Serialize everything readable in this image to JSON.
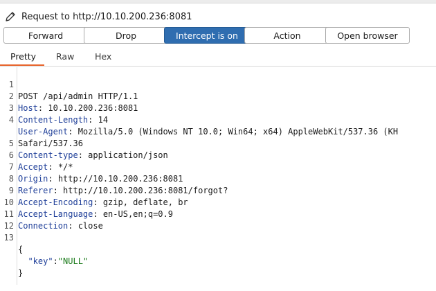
{
  "header": {
    "title": "Request to http://10.10.200.236:8081",
    "icon": "pencil-icon"
  },
  "toolbar": {
    "forward": "Forward",
    "drop": "Drop",
    "intercept": "Intercept is on",
    "action": "Action",
    "open_browser": "Open browser"
  },
  "colors": {
    "accent": "#2f6db0",
    "tab_underline": "#e8632b",
    "header_name": "#1f3f99",
    "string_value": "#1a7a1a"
  },
  "tabs": [
    "Pretty",
    "Raw",
    "Hex"
  ],
  "request": {
    "line_numbers": [
      "1",
      "2",
      "3",
      "4",
      "",
      "5",
      "6",
      "7",
      "8",
      "9",
      "10",
      "11",
      "12",
      "13",
      "",
      ""
    ],
    "request_line": "POST /api/admin HTTP/1.1",
    "headers": [
      {
        "name": "Host",
        "value": " 10.10.200.236:8081"
      },
      {
        "name": "Content-Length",
        "value": " 14"
      },
      {
        "name": "User-Agent",
        "value": " Mozilla/5.0 (Windows NT 10.0; Win64; x64) AppleWebKit/537.36 (KH"
      },
      {
        "name": "",
        "value": "Safari/537.36"
      },
      {
        "name": "Content-type",
        "value": " application/json"
      },
      {
        "name": "Accept",
        "value": " */*"
      },
      {
        "name": "Origin",
        "value": " http://10.10.200.236:8081"
      },
      {
        "name": "Referer",
        "value": " http://10.10.200.236:8081/forgot?"
      },
      {
        "name": "Accept-Encoding",
        "value": " gzip, deflate, br"
      },
      {
        "name": "Accept-Language",
        "value": " en-US,en;q=0.9"
      },
      {
        "name": "Connection",
        "value": " close"
      }
    ],
    "body": {
      "open": "{",
      "key": "\"key\"",
      "sep": ":",
      "value": "\"NULL\"",
      "close": "}"
    }
  }
}
